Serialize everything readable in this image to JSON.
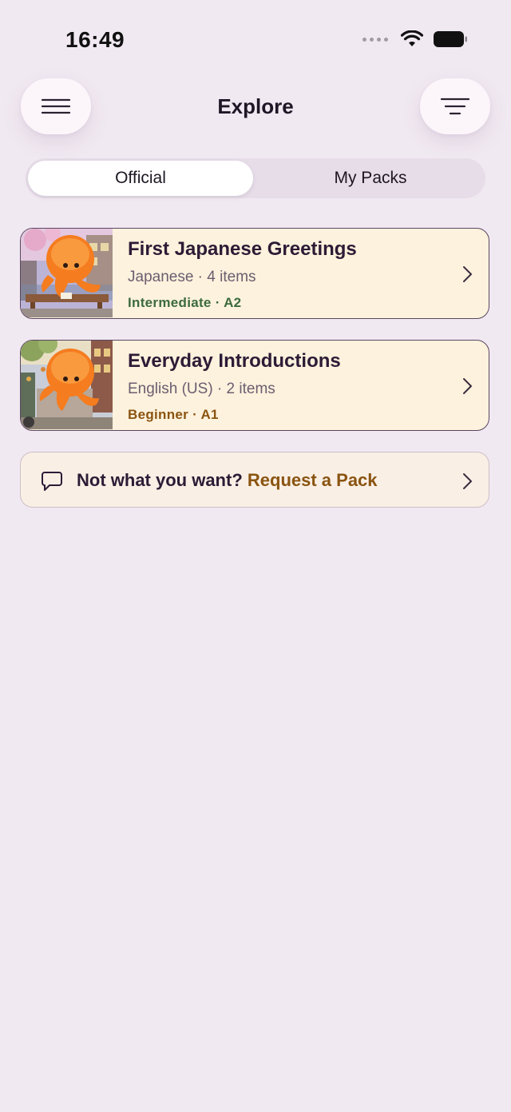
{
  "status_bar": {
    "time": "16:49"
  },
  "header": {
    "title": "Explore",
    "menu_icon": "hamburger-menu-icon",
    "filter_icon": "filter-icon"
  },
  "tabs": [
    {
      "label": "Official",
      "active": true
    },
    {
      "label": "My Packs",
      "active": false
    }
  ],
  "packs": [
    {
      "title": "First Japanese Greetings",
      "meta": "Japanese · 4 items",
      "level": "Intermediate · A2",
      "level_color": "#3c6a3e",
      "thumbnail": "octopus-writing-illustration"
    },
    {
      "title": "Everyday Introductions",
      "meta": "English (US) · 2 items",
      "level": "Beginner · A1",
      "level_color": "#8a5410",
      "thumbnail": "octopus-city-street-illustration"
    }
  ],
  "request": {
    "prefix": "Not what you want?",
    "link": "Request a Pack",
    "icon": "chat-bubble-icon"
  },
  "colors": {
    "background": "#f1e9f2",
    "card_background": "#fdf2dd",
    "accent_brown": "#8a5410",
    "accent_green": "#3c6a3e"
  }
}
